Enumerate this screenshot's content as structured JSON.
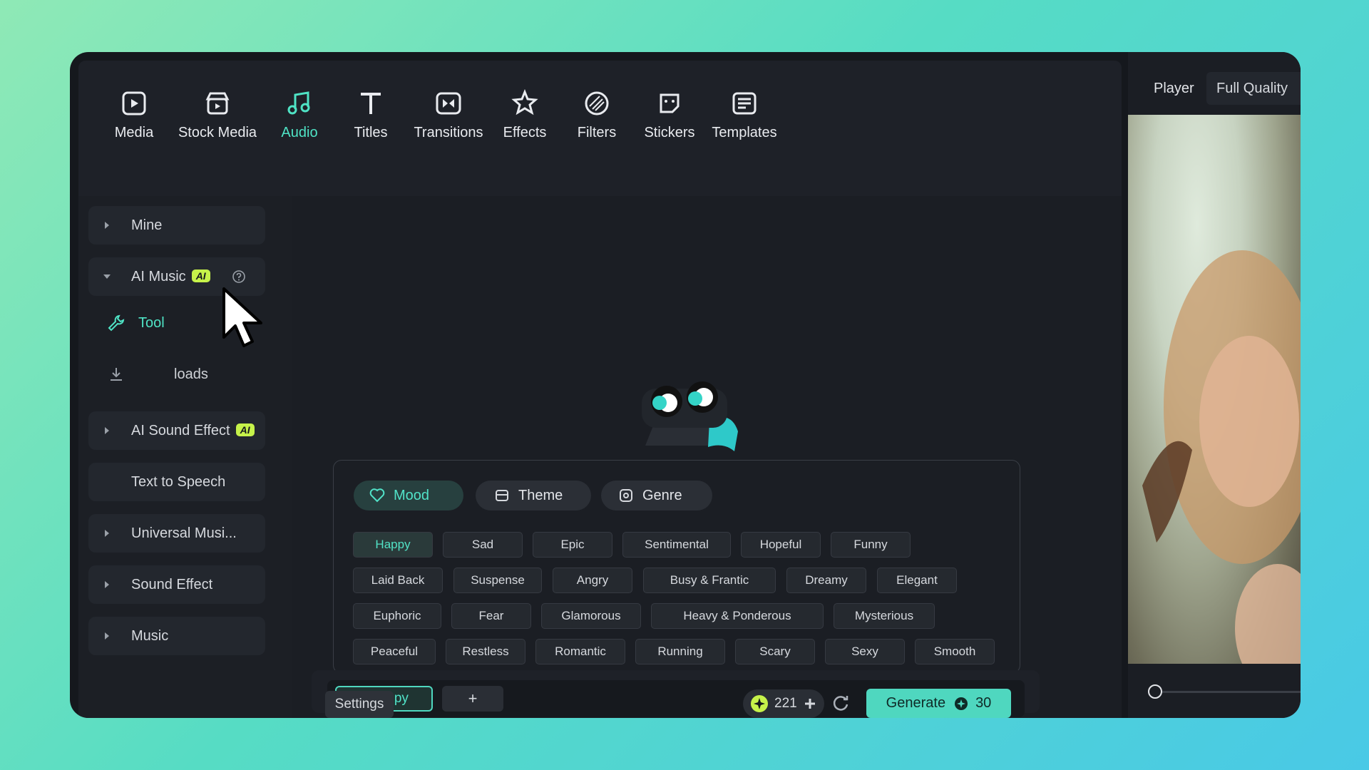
{
  "toolbar": {
    "items": [
      {
        "label": "Media",
        "icon": "media-icon"
      },
      {
        "label": "Stock Media",
        "icon": "stock-media-icon"
      },
      {
        "label": "Audio",
        "icon": "audio-icon",
        "active": true
      },
      {
        "label": "Titles",
        "icon": "titles-icon"
      },
      {
        "label": "Transitions",
        "icon": "transitions-icon"
      },
      {
        "label": "Effects",
        "icon": "effects-icon"
      },
      {
        "label": "Filters",
        "icon": "filters-icon"
      },
      {
        "label": "Stickers",
        "icon": "stickers-icon"
      },
      {
        "label": "Templates",
        "icon": "templates-icon"
      }
    ]
  },
  "sidebar": {
    "items": [
      {
        "label": "Mine",
        "expanded": false
      },
      {
        "label": "AI Music",
        "badge": "AI",
        "expanded": true
      },
      {
        "label": "AI Sound Effect",
        "badge": "AI",
        "expanded": false
      },
      {
        "label": "Text to Speech"
      },
      {
        "label": "Universal Musi...",
        "expanded": false
      },
      {
        "label": "Sound Effect",
        "expanded": false
      },
      {
        "label": "Music",
        "expanded": false
      }
    ],
    "sub_items": [
      {
        "label": "Tool",
        "active": true,
        "icon": "wrench-icon"
      },
      {
        "label": "loads",
        "icon": "download-icon"
      }
    ]
  },
  "tabs": [
    {
      "label": "Mood",
      "icon": "mood-icon",
      "active": true
    },
    {
      "label": "Theme",
      "icon": "theme-icon"
    },
    {
      "label": "Genre",
      "icon": "genre-icon"
    }
  ],
  "moods": [
    [
      "Happy",
      "Sad",
      "Epic",
      "Sentimental",
      "Hopeful",
      "Funny"
    ],
    [
      "Laid Back",
      "Suspense",
      "Angry",
      "Busy & Frantic",
      "Dreamy",
      "Elegant"
    ],
    [
      "Euphoric",
      "Fear",
      "Glamorous",
      "Heavy & Ponderous",
      "Mysterious"
    ],
    [
      "Peaceful",
      "Restless",
      "Romantic",
      "Running",
      "Scary",
      "Sexy",
      "Smooth"
    ]
  ],
  "selected_mood": "Happy",
  "add_label": "+",
  "settings_label": "Settings",
  "credits": "221",
  "generate": {
    "label": "Generate",
    "cost": "30"
  },
  "player": {
    "label": "Player",
    "quality": "Full Quality"
  },
  "colors": {
    "accent": "#4fe3c5",
    "badge": "#c6f24a",
    "generate_bg": "#4fd7bf"
  }
}
